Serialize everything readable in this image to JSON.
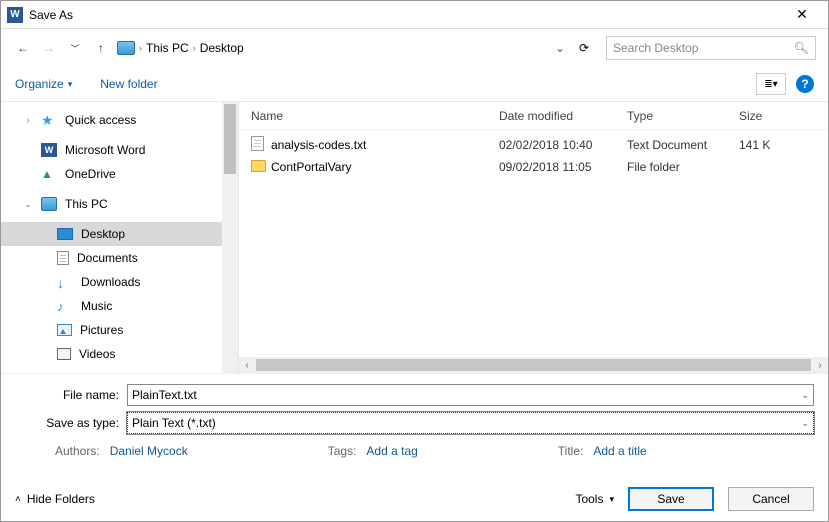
{
  "window": {
    "title": "Save As"
  },
  "nav": {
    "breadcrumb": [
      "This PC",
      "Desktop"
    ],
    "search_placeholder": "Search Desktop"
  },
  "toolbar": {
    "organize": "Organize",
    "new_folder": "New folder"
  },
  "sidebar": {
    "items": [
      {
        "label": "Quick access",
        "icon": "star"
      },
      {
        "label": "Microsoft Word",
        "icon": "word"
      },
      {
        "label": "OneDrive",
        "icon": "cloud"
      },
      {
        "label": "This PC",
        "icon": "monitor",
        "expanded": true
      },
      {
        "label": "Desktop",
        "icon": "desktop",
        "selected": true,
        "indent": true
      },
      {
        "label": "Documents",
        "icon": "doc",
        "indent": true
      },
      {
        "label": "Downloads",
        "icon": "down",
        "indent": true
      },
      {
        "label": "Music",
        "icon": "music",
        "indent": true
      },
      {
        "label": "Pictures",
        "icon": "pic",
        "indent": true
      },
      {
        "label": "Videos",
        "icon": "video",
        "indent": true
      }
    ]
  },
  "columns": {
    "name": "Name",
    "date": "Date modified",
    "type": "Type",
    "size": "Size"
  },
  "files": [
    {
      "name": "analysis-codes.txt",
      "date": "02/02/2018 10:40",
      "type": "Text Document",
      "size": "141 K",
      "icon": "txt"
    },
    {
      "name": "ContPortalVary",
      "date": "09/02/2018 11:05",
      "type": "File folder",
      "size": "",
      "icon": "folder"
    }
  ],
  "form": {
    "filename_label": "File name:",
    "filename_value": "PlainText.txt",
    "saveastype_label": "Save as type:",
    "saveastype_value": "Plain Text (*.txt)",
    "authors_label": "Authors:",
    "authors_value": "Daniel Mycock",
    "tags_label": "Tags:",
    "tags_value": "Add a tag",
    "title_label": "Title:",
    "title_value": "Add a title"
  },
  "footer": {
    "hide_folders": "Hide Folders",
    "tools": "Tools",
    "save": "Save",
    "cancel": "Cancel"
  }
}
